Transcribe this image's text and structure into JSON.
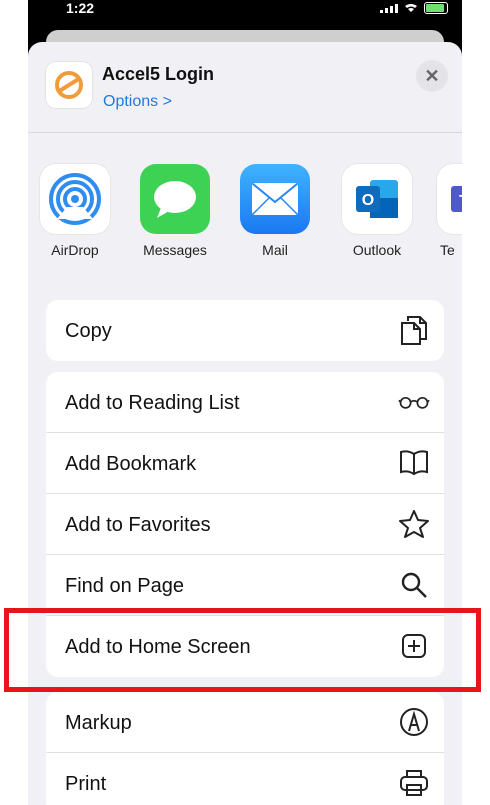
{
  "status": {
    "time": "1:22"
  },
  "header": {
    "title": "Accel5 Login",
    "options": "Options >",
    "close": "✕"
  },
  "apps": [
    {
      "label": "AirDrop"
    },
    {
      "label": "Messages"
    },
    {
      "label": "Mail"
    },
    {
      "label": "Outlook",
      "glyph": "O"
    },
    {
      "label": "Te",
      "glyph": "T"
    }
  ],
  "actions": {
    "copy": "Copy",
    "reading_list": "Add to Reading List",
    "bookmark": "Add Bookmark",
    "favorites": "Add to Favorites",
    "find": "Find on Page",
    "home_screen": "Add to Home Screen",
    "markup": "Markup",
    "print": "Print"
  },
  "colors": {
    "highlight": "#e8131b",
    "link": "#1f7ae0",
    "sheet": "#f1f1f5"
  }
}
